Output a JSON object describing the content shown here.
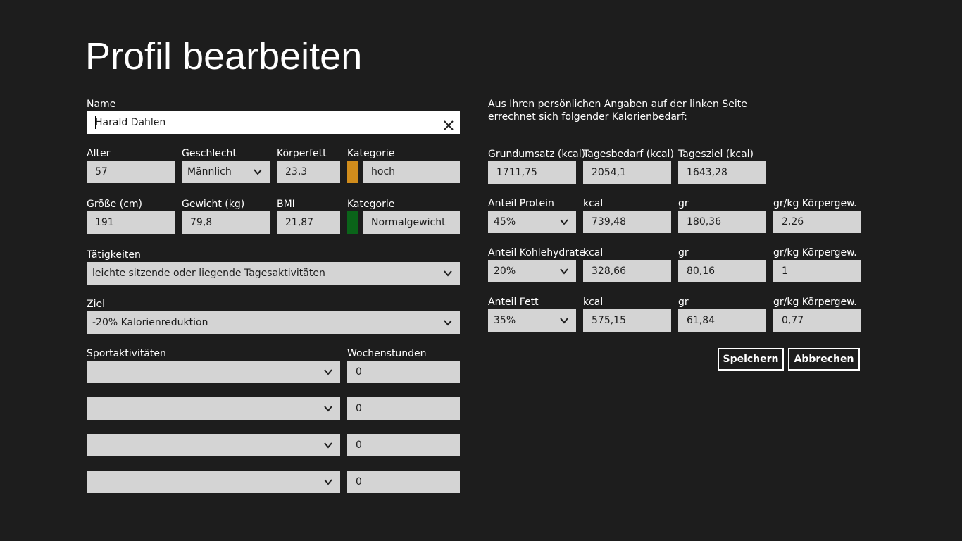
{
  "page": {
    "title": "Profil bearbeiten"
  },
  "colors": {
    "category_high": "#d08c1c",
    "category_normal": "#0a6419"
  },
  "left": {
    "name": {
      "label": "Name",
      "value": "Harald Dahlen"
    },
    "alter": {
      "label": "Alter",
      "value": "57"
    },
    "geschlecht": {
      "label": "Geschlecht",
      "value": "Männlich"
    },
    "koerperfett": {
      "label": "Körperfett",
      "value": "23,3"
    },
    "kategorie1": {
      "label": "Kategorie",
      "value": "hoch"
    },
    "groesse": {
      "label": "Größe (cm)",
      "value": "191"
    },
    "gewicht": {
      "label": "Gewicht (kg)",
      "value": "79,8"
    },
    "bmi": {
      "label": "BMI",
      "value": "21,87"
    },
    "kategorie2": {
      "label": "Kategorie",
      "value": "Normalgewicht"
    },
    "taetigkeiten": {
      "label": "Tätigkeiten",
      "value": "leichte sitzende oder liegende Tagesaktivitäten"
    },
    "ziel": {
      "label": "Ziel",
      "value": "-20% Kalorienreduktion"
    },
    "sport": {
      "label": "Sportaktivitäten",
      "hours_label": "Wochenstunden",
      "rows": [
        {
          "activity": "",
          "hours": "0"
        },
        {
          "activity": "",
          "hours": "0"
        },
        {
          "activity": "",
          "hours": "0"
        },
        {
          "activity": "",
          "hours": "0"
        }
      ]
    }
  },
  "right": {
    "intro": "Aus Ihren persönlichen Angaben auf der linken Seite errechnet sich folgender Kalorienbedarf:",
    "grundumsatz": {
      "label": "Grundumsatz (kcal)",
      "value": "1711,75"
    },
    "tagesbedarf": {
      "label": "Tagesbedarf (kcal)",
      "value": "2054,1"
    },
    "tagesziel": {
      "label": "Tagesziel (kcal)",
      "value": "1643,28"
    },
    "macros": [
      {
        "label": "Anteil Protein",
        "pct": "45%",
        "kcal_label": "kcal",
        "kcal": "739,48",
        "gr_label": "gr",
        "gr": "180,36",
        "grkg_label": "gr/kg Körpergew.",
        "grkg": "2,26"
      },
      {
        "label": "Anteil Kohlehydrate",
        "pct": "20%",
        "kcal_label": "kcal",
        "kcal": "328,66",
        "gr_label": "gr",
        "gr": "80,16",
        "grkg_label": "gr/kg Körpergew.",
        "grkg": "1"
      },
      {
        "label": "Anteil Fett",
        "pct": "35%",
        "kcal_label": "kcal",
        "kcal": "575,15",
        "gr_label": "gr",
        "gr": "61,84",
        "grkg_label": "gr/kg Körpergew.",
        "grkg": "0,77"
      }
    ],
    "buttons": {
      "save": "Speichern",
      "cancel": "Abbrechen"
    }
  },
  "icons": {
    "dropdown": "chevron-down-icon",
    "clear": "close-icon"
  }
}
